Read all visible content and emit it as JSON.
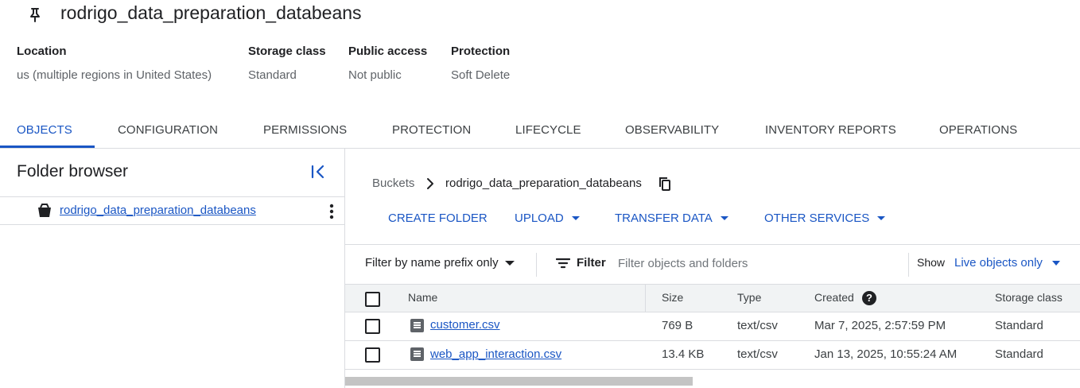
{
  "header": {
    "title": "rodrigo_data_preparation_databeans",
    "pin_icon": "pin-icon"
  },
  "meta": [
    {
      "label": "Location",
      "value": "us (multiple regions in United States)"
    },
    {
      "label": "Storage class",
      "value": "Standard"
    },
    {
      "label": "Public access",
      "value": "Not public"
    },
    {
      "label": "Protection",
      "value": "Soft Delete"
    }
  ],
  "tabs": [
    {
      "label": "OBJECTS",
      "active": true
    },
    {
      "label": "CONFIGURATION"
    },
    {
      "label": "PERMISSIONS"
    },
    {
      "label": "PROTECTION"
    },
    {
      "label": "LIFECYCLE"
    },
    {
      "label": "OBSERVABILITY"
    },
    {
      "label": "INVENTORY REPORTS"
    },
    {
      "label": "OPERATIONS"
    }
  ],
  "folder_browser": {
    "title": "Folder browser",
    "collapse_icon": "collapse-left-icon",
    "bucket": "rodrigo_data_preparation_databeans"
  },
  "breadcrumb": {
    "root": "Buckets",
    "current": "rodrigo_data_preparation_databeans"
  },
  "actions": {
    "create_folder": "CREATE FOLDER",
    "upload": "UPLOAD",
    "transfer_data": "TRANSFER DATA",
    "other_services": "OTHER SERVICES"
  },
  "filter": {
    "prefix_mode": "Filter by name prefix only",
    "label": "Filter",
    "placeholder": "Filter objects and folders",
    "show_label": "Show",
    "show_value": "Live objects only"
  },
  "table": {
    "columns": [
      "Name",
      "Size",
      "Type",
      "Created",
      "Storage class"
    ],
    "rows": [
      {
        "name": "customer.csv",
        "size": "769 B",
        "type": "text/csv",
        "created": "Mar 7, 2025, 2:57:59 PM",
        "storage_class": "Standard"
      },
      {
        "name": "web_app_interaction.csv",
        "size": "13.4 KB",
        "type": "text/csv",
        "created": "Jan 13, 2025, 10:55:24 AM",
        "storage_class": "Standard"
      }
    ]
  },
  "colors": {
    "accent": "#1a56c4",
    "text": "#202124",
    "muted": "#5f6368",
    "border": "#dadce0"
  }
}
